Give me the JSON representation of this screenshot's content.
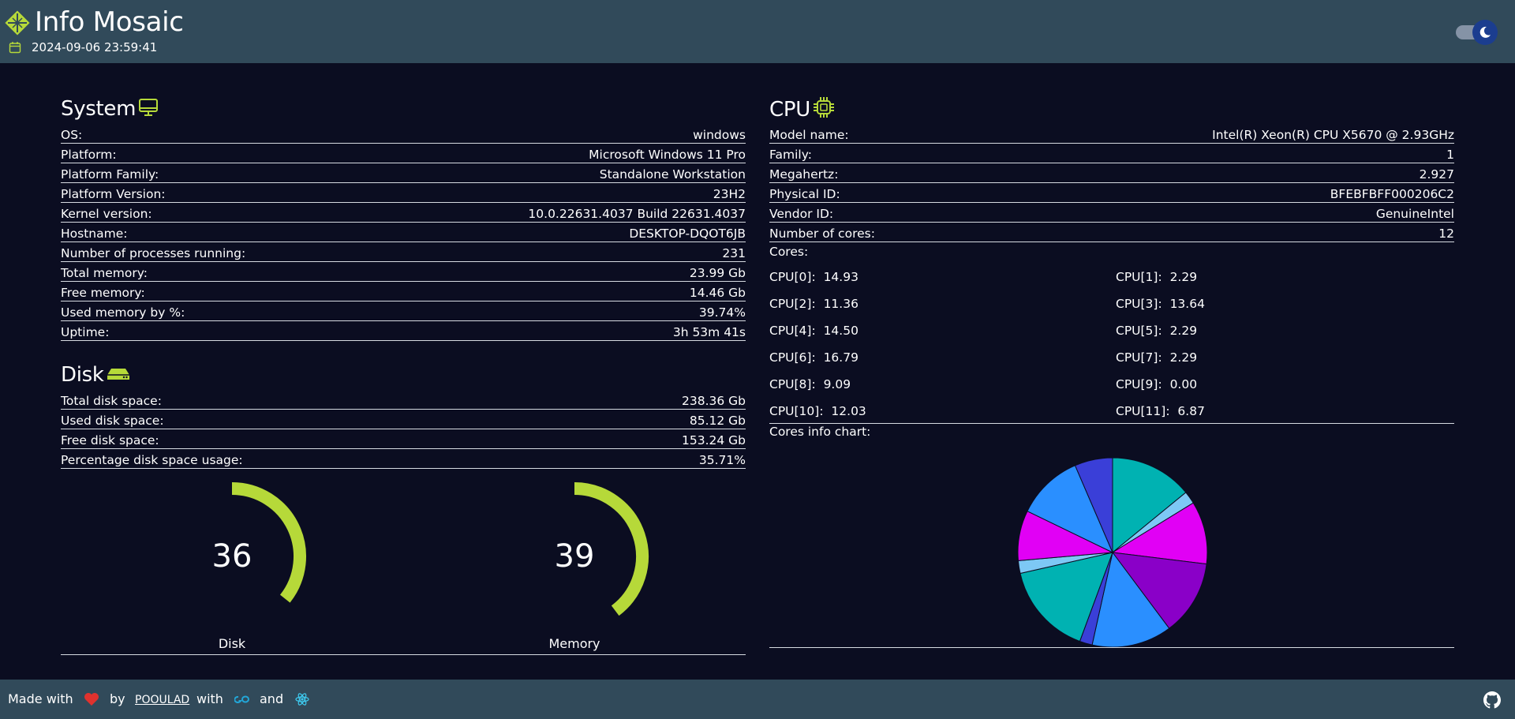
{
  "header": {
    "title": "Info Mosaic",
    "datetime": "2024-09-06 23:59:41",
    "theme_toggle": "dark-mode"
  },
  "system": {
    "title": "System",
    "rows": [
      {
        "label": "OS:",
        "value": "windows"
      },
      {
        "label": "Platform:",
        "value": "Microsoft Windows 11 Pro"
      },
      {
        "label": "Platform Family:",
        "value": "Standalone Workstation"
      },
      {
        "label": "Platform Version:",
        "value": "23H2"
      },
      {
        "label": "Kernel version:",
        "value": "10.0.22631.4037 Build 22631.4037"
      },
      {
        "label": "Hostname:",
        "value": "DESKTOP-DQOT6JB"
      },
      {
        "label": "Number of processes running:",
        "value": "231"
      },
      {
        "label": "Total memory:",
        "value": "23.99 Gb"
      },
      {
        "label": "Free memory:",
        "value": "14.46 Gb"
      },
      {
        "label": "Used memory by %:",
        "value": "39.74%"
      },
      {
        "label": "Uptime:",
        "value": "3h 53m 41s"
      }
    ]
  },
  "disk": {
    "title": "Disk",
    "rows": [
      {
        "label": "Total disk space:",
        "value": "238.36 Gb"
      },
      {
        "label": "Used disk space:",
        "value": "85.12 Gb"
      },
      {
        "label": "Free disk space:",
        "value": "153.24 Gb"
      },
      {
        "label": "Percentage disk space usage:",
        "value": "35.71%"
      }
    ]
  },
  "gauges": [
    {
      "value": "36",
      "label": "Disk",
      "percent": 35.71
    },
    {
      "value": "39",
      "label": "Memory",
      "percent": 39.74
    }
  ],
  "cpu": {
    "title": "CPU",
    "rows": [
      {
        "label": "Model name:",
        "value": "Intel(R) Xeon(R) CPU X5670 @ 2.93GHz"
      },
      {
        "label": "Family:",
        "value": "1"
      },
      {
        "label": "Megahertz:",
        "value": "2.927"
      },
      {
        "label": "Physical ID:",
        "value": "BFEBFBFF000206C2"
      },
      {
        "label": "Vendor ID:",
        "value": "GenuineIntel"
      },
      {
        "label": "Number of cores:",
        "value": "12"
      }
    ],
    "cores_label": "Cores:",
    "cores": [
      {
        "name": "CPU[0]:",
        "value": "14.93"
      },
      {
        "name": "CPU[1]:",
        "value": "2.29"
      },
      {
        "name": "CPU[2]:",
        "value": "11.36"
      },
      {
        "name": "CPU[3]:",
        "value": "13.64"
      },
      {
        "name": "CPU[4]:",
        "value": "14.50"
      },
      {
        "name": "CPU[5]:",
        "value": "2.29"
      },
      {
        "name": "CPU[6]:",
        "value": "16.79"
      },
      {
        "name": "CPU[7]:",
        "value": "2.29"
      },
      {
        "name": "CPU[8]:",
        "value": "9.09"
      },
      {
        "name": "CPU[9]:",
        "value": "0.00"
      },
      {
        "name": "CPU[10]:",
        "value": "12.03"
      },
      {
        "name": "CPU[11]:",
        "value": "6.87"
      }
    ],
    "chart_label": "Cores info chart:"
  },
  "chart_data": {
    "type": "pie",
    "title": "",
    "categories": [
      "CPU[0]",
      "CPU[1]",
      "CPU[2]",
      "CPU[3]",
      "CPU[4]",
      "CPU[5]",
      "CPU[6]",
      "CPU[7]",
      "CPU[8]",
      "CPU[9]",
      "CPU[10]",
      "CPU[11]"
    ],
    "values": [
      14.93,
      2.29,
      11.36,
      13.64,
      14.5,
      2.29,
      16.79,
      2.29,
      9.09,
      0.0,
      12.03,
      6.87
    ],
    "colors": [
      "#00b2b2",
      "#7dc8f5",
      "#e100f5",
      "#8a00c8",
      "#2a8fff",
      "#3a3fd8",
      "#00b2b2",
      "#7dc8f5",
      "#e100f5",
      "#8a00c8",
      "#2a8fff",
      "#3a3fd8"
    ]
  },
  "footer": {
    "made_with": "Made with",
    "by": "by",
    "author": "POOULAD",
    "with": "with",
    "and": "and",
    "icons": [
      "heart-icon",
      "go-icon",
      "react-icon",
      "github-icon"
    ]
  },
  "colors": {
    "accent": "#b6d939",
    "header_bg": "#314a5a",
    "page_bg": "#0b0d21"
  }
}
